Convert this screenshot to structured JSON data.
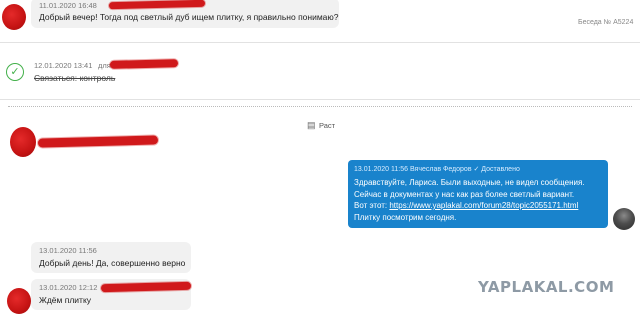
{
  "top_message": {
    "timestamp": "11.01.2020 16:48",
    "text": "Добрый вечер! Тогда под светлый дуб ищем плитку, я правильно понимаю?",
    "conversation_label": "Беседа № A5224"
  },
  "task": {
    "timestamp": "12.01.2020 13:41",
    "prefix": "для",
    "text": "Связаться: контроль"
  },
  "post_label": "Раст",
  "outgoing": {
    "timestamp": "13.01.2020 11:56",
    "author": "Вячеслав Федоров",
    "status": "✓ Доставлено",
    "lines": [
      "Здравствуйте, Лариса. Были выходные, не видел сообщения.",
      "Сейчас в документах у нас как раз более светлый вариант.",
      "Вот этот: ",
      "Плитку посмотрим сегодня."
    ],
    "link": "https://www.yaplakal.com/forum28/topic2055171.html"
  },
  "reply1": {
    "timestamp": "13.01.2020 11:56",
    "text": "Добрый день! Да, совершенно верно"
  },
  "reply2": {
    "timestamp": "13.01.2020 12:12",
    "text": "Ждём плитку"
  },
  "watermark": "YAPLAKAL.COM",
  "colors": {
    "accent_blue": "#1983cc",
    "check_green": "#43b04a",
    "redaction_red": "#d0191b"
  }
}
